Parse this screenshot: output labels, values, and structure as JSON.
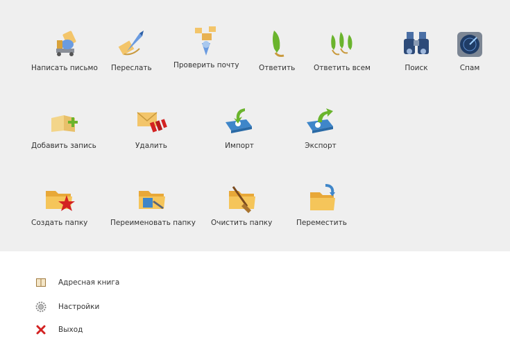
{
  "toolbar": {
    "row1": [
      {
        "id": "compose",
        "label": "Написать письмо",
        "icon": "compose-letter-cart-icon"
      },
      {
        "id": "forward",
        "label": "Переслать",
        "icon": "forward-arrow-envelope-icon"
      },
      {
        "id": "check-mail",
        "label": "Проверить почту",
        "icon": "check-mail-icon"
      },
      {
        "id": "reply",
        "label": "Ответить",
        "icon": "reply-arrow-icon"
      },
      {
        "id": "reply-all",
        "label": "Ответить всем",
        "icon": "reply-all-arrows-icon"
      },
      {
        "id": "search",
        "label": "Поиск",
        "icon": "binoculars-icon"
      },
      {
        "id": "spam",
        "label": "Спам",
        "icon": "spam-radar-icon"
      }
    ],
    "row2": [
      {
        "id": "add-entry",
        "label": "Добавить запись",
        "icon": "add-entry-book-icon"
      },
      {
        "id": "delete",
        "label": "Удалить",
        "icon": "delete-envelope-dynamite-icon"
      },
      {
        "id": "import",
        "label": "Импорт",
        "icon": "import-book-icon"
      },
      {
        "id": "export",
        "label": "Экспорт",
        "icon": "export-book-icon"
      }
    ],
    "row3": [
      {
        "id": "create-folder",
        "label": "Создать папку",
        "icon": "create-folder-star-icon"
      },
      {
        "id": "rename-folder",
        "label": "Переименовать папку",
        "icon": "rename-folder-icon"
      },
      {
        "id": "clear-folder",
        "label": "Очистить папку",
        "icon": "clear-folder-broom-icon"
      },
      {
        "id": "move-folder",
        "label": "Переместить",
        "icon": "move-folder-icon"
      }
    ]
  },
  "links": [
    {
      "id": "address-book",
      "label": "Адресная книга",
      "icon": "address-book-icon"
    },
    {
      "id": "settings",
      "label": "Настройки",
      "icon": "gear-icon"
    },
    {
      "id": "logout",
      "label": "Выход",
      "icon": "close-x-icon"
    }
  ],
  "colors": {
    "panel_bg": "#efefef",
    "folder": "#f5b942",
    "envelope": "#f3c56a",
    "green": "#6ab42d",
    "blue": "#3f86c9",
    "red": "#d32222"
  }
}
